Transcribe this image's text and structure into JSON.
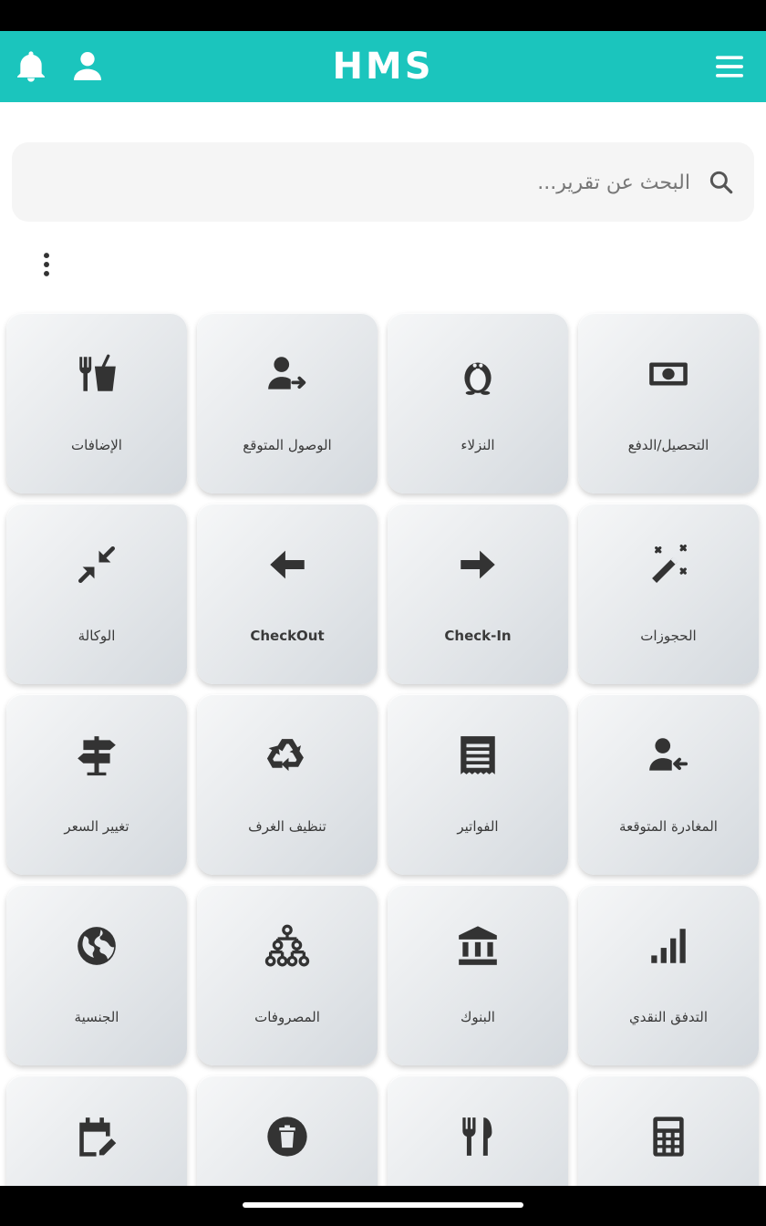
{
  "header": {
    "brand": "HMS",
    "icons": {
      "bell": "bell-icon",
      "user": "user-icon",
      "menu": "hamburger-menu-icon"
    },
    "color": "#1bc5bd"
  },
  "search": {
    "placeholder": "البحث عن تقرير...",
    "value": "",
    "icon": "search-icon"
  },
  "tiles": [
    {
      "label": "التحصيل/الدفع",
      "icon": "money-icon"
    },
    {
      "label": "النزلاء",
      "icon": "penguin-icon"
    },
    {
      "label": "الوصول المتوقع",
      "icon": "person-arrow-right-icon"
    },
    {
      "label": "الإضافات",
      "icon": "fastfood-icon"
    },
    {
      "label": "الحجوزات",
      "icon": "magic-wand-icon"
    },
    {
      "label": "Check-In",
      "icon": "arrow-right-icon"
    },
    {
      "label": "CheckOut",
      "icon": "arrow-left-icon"
    },
    {
      "label": "الوكالة",
      "icon": "compress-arrows-icon"
    },
    {
      "label": "المغادرة المتوقعة",
      "icon": "person-arrow-left-icon"
    },
    {
      "label": "الفواتير",
      "icon": "receipt-icon"
    },
    {
      "label": "تنظيف الغرف",
      "icon": "recycle-icon"
    },
    {
      "label": "تغيير السعر",
      "icon": "signpost-icon"
    },
    {
      "label": "التدفق النقدي",
      "icon": "signal-bars-icon"
    },
    {
      "label": "البنوك",
      "icon": "bank-icon"
    },
    {
      "label": "المصروفات",
      "icon": "sitemap-icon"
    },
    {
      "label": "الجنسية",
      "icon": "globe-icon"
    },
    {
      "label": "",
      "icon": "calculator-icon"
    },
    {
      "label": "",
      "icon": "utensils-icon"
    },
    {
      "label": "",
      "icon": "trash-circle-icon"
    },
    {
      "label": "",
      "icon": "calendar-edit-icon"
    }
  ]
}
